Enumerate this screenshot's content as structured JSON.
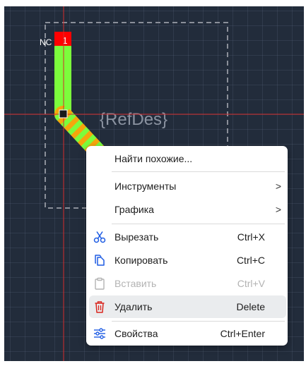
{
  "canvas": {
    "pad_net_label": "NC",
    "pad_number": "1",
    "refdes_text": "{RefDes}"
  },
  "context_menu": {
    "items": [
      {
        "label": "Найти похожие...",
        "shortcut": "",
        "icon": "",
        "submenu": false,
        "enabled": true
      },
      {
        "label": "Инструменты",
        "shortcut": "",
        "icon": "",
        "submenu": true,
        "enabled": true
      },
      {
        "label": "Графика",
        "shortcut": "",
        "icon": "",
        "submenu": true,
        "enabled": true
      },
      {
        "label": "Вырезать",
        "shortcut": "Ctrl+X",
        "icon": "scissors-icon",
        "submenu": false,
        "enabled": true
      },
      {
        "label": "Копировать",
        "shortcut": "Ctrl+C",
        "icon": "copy-icon",
        "submenu": false,
        "enabled": true
      },
      {
        "label": "Вставить",
        "shortcut": "Ctrl+V",
        "icon": "clipboard-paste-icon",
        "submenu": false,
        "enabled": false
      },
      {
        "label": "Удалить",
        "shortcut": "Delete",
        "icon": "trash-icon",
        "submenu": false,
        "enabled": true,
        "highlighted": true
      },
      {
        "label": "Свойства",
        "shortcut": "Ctrl+Enter",
        "icon": "sliders-icon",
        "submenu": false,
        "enabled": true
      }
    ],
    "submenu_arrow": ">"
  },
  "colors": {
    "canvas_bg": "#222c3b",
    "trace_green": "#7cfc3c",
    "trace_orange": "#f5a60c",
    "pad_red": "#ff0000",
    "crosshair": "#d42b2b",
    "accent_blue": "#1e5ce3",
    "delete_red": "#d9251d"
  }
}
